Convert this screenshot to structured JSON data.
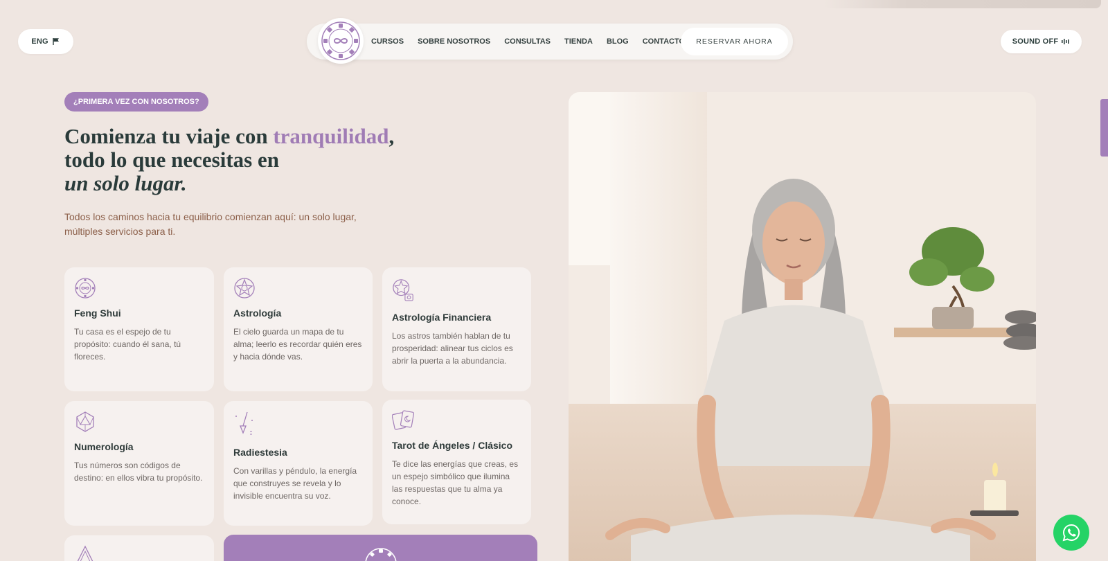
{
  "header": {
    "lang_label": "ENG",
    "sound_label": "SOUND OFF",
    "nav_items": [
      "CURSOS",
      "SOBRE NOSOTROS",
      "CONSULTAS",
      "TIENDA",
      "BLOG",
      "CONTACTO"
    ],
    "reserve_label": "RESERVAR AHORA"
  },
  "hero": {
    "badge": "¿PRIMERA VEZ CON NOSOTROS?",
    "title_part1": "Comienza tu viaje con ",
    "title_accent": "tranquilidad",
    "title_part2": ",",
    "title_line2": "todo lo que necesitas en",
    "title_line3": "un solo lugar.",
    "intro": "Todos los caminos hacia tu equilibrio comienzan aquí: un solo lugar, múltiples servicios para ti."
  },
  "services": [
    {
      "icon": "feng-shui-icon",
      "title": "Feng Shui",
      "text": "Tu casa es el espejo de tu propósito: cuando él sana, tú floreces."
    },
    {
      "icon": "astrology-icon",
      "title": "Astrología",
      "text": "El cielo guarda un mapa de tu alma; leerlo es recordar quién eres y hacia dónde vas."
    },
    {
      "icon": "financial-astrology-icon",
      "title": "Astrología Financiera",
      "text": "Los astros también hablan de tu prosperidad: alinear tus ciclos es abrir la puerta a la abundancia."
    },
    {
      "icon": "numerology-icon",
      "title": "Numerología",
      "text": "Tus números son códigos de destino: en ellos vibra tu propósito."
    },
    {
      "icon": "pendulum-icon",
      "title": "Radiestesia",
      "text": "Con varillas y péndulo, la energía que construyes se revela y lo invisible encuentra su voz."
    },
    {
      "icon": "tarot-cards-icon",
      "title": "Tarot de Ángeles / Clásico",
      "text": "Te dice las energías que creas, es un espejo simbólico que ilumina las respuestas que tu alma ya conoce."
    }
  ],
  "colors": {
    "background": "#efe6e1",
    "accent": "#a37fb9",
    "card": "#f6f1ef",
    "whatsapp": "#25d366"
  }
}
